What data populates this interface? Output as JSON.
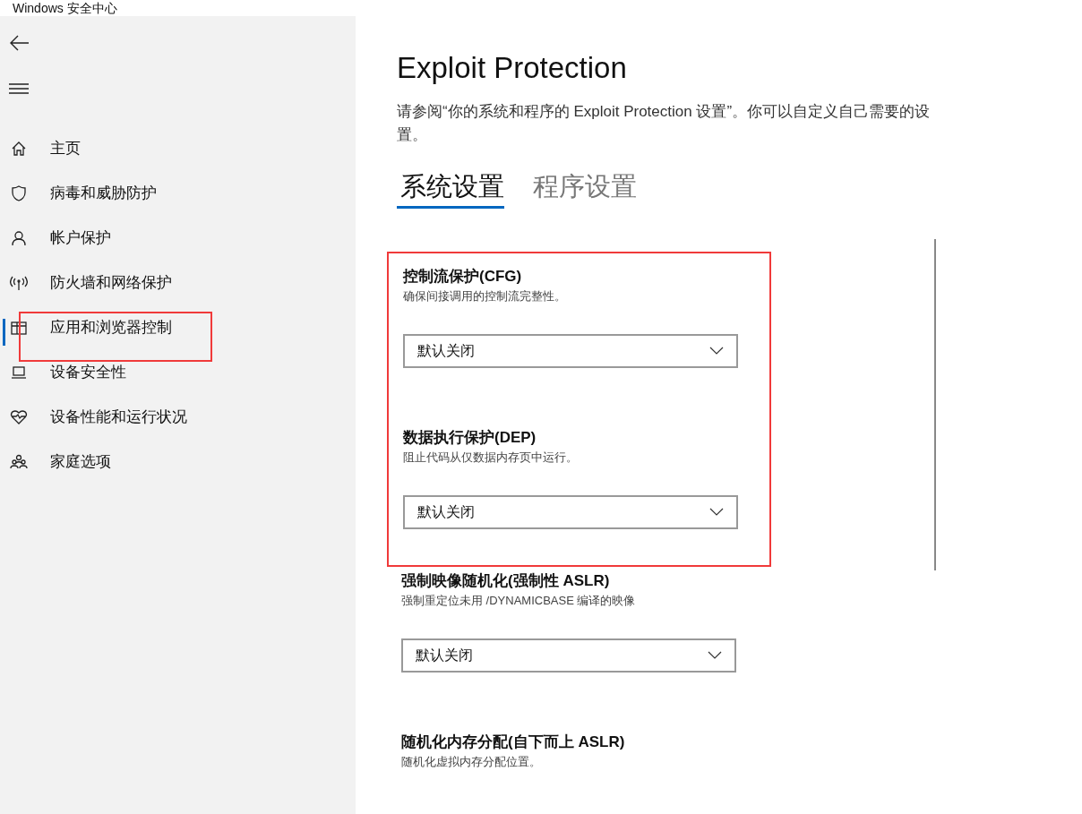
{
  "window": {
    "title": "Windows 安全中心"
  },
  "sidebar": {
    "items": [
      {
        "label": "主页",
        "kind": "home",
        "selected": false,
        "highlighted": false
      },
      {
        "label": "病毒和威胁防护",
        "kind": "shield",
        "selected": false,
        "highlighted": false
      },
      {
        "label": "帐户保护",
        "kind": "person",
        "selected": false,
        "highlighted": false
      },
      {
        "label": "防火墙和网络保护",
        "kind": "antenna",
        "selected": false,
        "highlighted": false
      },
      {
        "label": "应用和浏览器控制",
        "kind": "window",
        "selected": true,
        "highlighted": true
      },
      {
        "label": "设备安全性",
        "kind": "laptop",
        "selected": false,
        "highlighted": false
      },
      {
        "label": "设备性能和运行状况",
        "kind": "heart",
        "selected": false,
        "highlighted": false
      },
      {
        "label": "家庭选项",
        "kind": "family",
        "selected": false,
        "highlighted": false
      }
    ]
  },
  "page": {
    "title": "Exploit Protection",
    "description": "请参阅“你的系统和程序的 Exploit Protection 设置”。你可以自定义自己需要的设置。"
  },
  "tabs": [
    {
      "label": "系统设置",
      "selected": true
    },
    {
      "label": "程序设置",
      "selected": false
    }
  ],
  "settings": [
    {
      "title": "控制流保护(CFG)",
      "description": "确保间接调用的控制流完整性。",
      "value": "默认关闭",
      "highlighted": true
    },
    {
      "title": "数据执行保护(DEP)",
      "description": "阻止代码从仅数据内存页中运行。",
      "value": "默认关闭",
      "highlighted": true
    },
    {
      "title": "强制映像随机化(强制性 ASLR)",
      "description": "强制重定位未用 /DYNAMICBASE 编译的映像",
      "value": "默认关闭",
      "highlighted": false
    },
    {
      "title": "随机化内存分配(自下而上 ASLR)",
      "description": "随机化虚拟内存分配位置。"
    }
  ]
}
